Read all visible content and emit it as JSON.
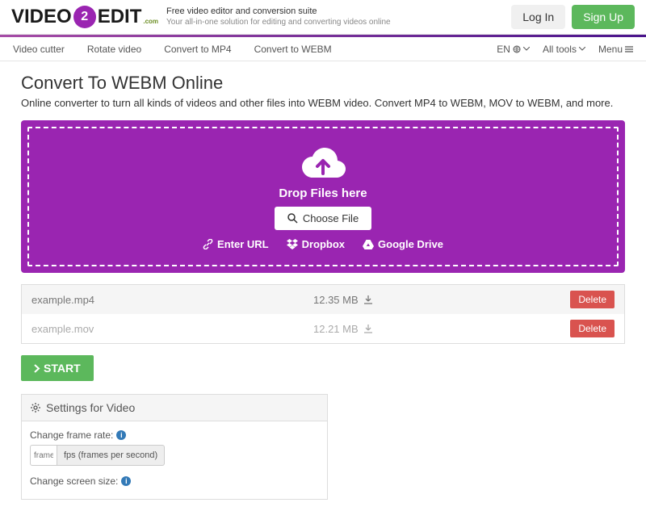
{
  "header": {
    "logo_pre": "VIDEO",
    "logo_badge": "2",
    "logo_post": "EDIT",
    "logo_suffix": ".com",
    "tagline1": "Free video editor and conversion suite",
    "tagline2": "Your all-in-one solution for editing and converting videos online",
    "login": "Log In",
    "signup": "Sign Up"
  },
  "subnav": {
    "items": [
      "Video cutter",
      "Rotate video",
      "Convert to MP4",
      "Convert to WEBM"
    ],
    "lang": "EN",
    "alltools": "All tools",
    "menu": "Menu"
  },
  "page": {
    "title": "Convert To WEBM Online",
    "subtitle": "Online converter to turn all kinds of videos and other files into WEBM video. Convert MP4 to WEBM, MOV to WEBM, and more."
  },
  "dropzone": {
    "label": "Drop Files here",
    "choose": "Choose File",
    "url": "Enter URL",
    "dropbox": "Dropbox",
    "gdrive": "Google Drive"
  },
  "files": [
    {
      "name": "example.mp4",
      "size": "12.35 MB",
      "delete": "Delete"
    },
    {
      "name": "example.mov",
      "size": "12.21 MB",
      "delete": "Delete"
    }
  ],
  "start": "START",
  "settings": {
    "header": "Settings for Video",
    "framerate_label": "Change frame rate:",
    "framerate_ph": "frames",
    "framerate_addon": "fps (frames per second)",
    "screensize_label": "Change screen size:"
  }
}
